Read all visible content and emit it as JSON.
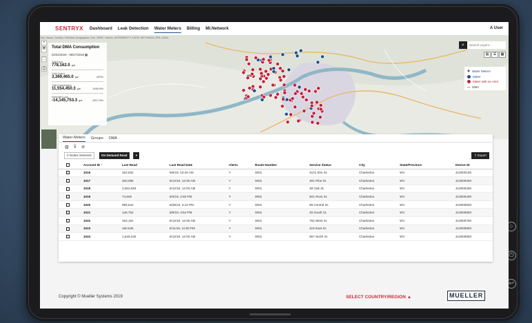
{
  "nav": {
    "logo": "SENTRYX",
    "items": [
      "Dashboard",
      "Leak Detection",
      "Water Meters",
      "Billing",
      "MI.Network"
    ],
    "active_index": 2,
    "user": "A User"
  },
  "map": {
    "attribution": "Esri, Maxar, GeoEye, Earthstar Geographics, Esri, HERE, Garmin, INCREMENT P, USGS, METI/NASA, EPA, USDA",
    "search_placeholder": "Search Layers...",
    "consumption": {
      "title": "Total DMA Consumption",
      "date_range": "01/01/2019  -  09/17/2019",
      "total_input_label": "Total Input",
      "total_input": "778,162.0",
      "total_output_label": "Total Output",
      "total_output": "3,369,465.0",
      "total_output_pct": "433%",
      "total_consumption_label": "Total Consumption",
      "total_consumption": "11,554,450.3",
      "total_consumption_pct": "1484.8%",
      "estimated_loss_label": "Estimated Loss",
      "estimated_loss": "-14,145,753.3",
      "estimated_loss_pct": "-1817.8%",
      "unit": "gal"
    },
    "legend": {
      "water_meters": "Water Meters",
      "meter": "Meter",
      "meter_alert": "Meter with an Alert",
      "dma": "DMA"
    },
    "colors": {
      "meter": "#1b4f8a",
      "alert": "#c0223a"
    }
  },
  "panel": {
    "tabs": [
      "Water Meters",
      "Groups",
      "DMA"
    ],
    "nodes_selected": "0 Nodes Selected",
    "on_demand_read": "On Demand Read",
    "export": "Export",
    "columns": [
      "Account ID",
      "Last Read",
      "Last Read Date",
      "Alerts",
      "Route Number",
      "Service Status",
      "City",
      "State/Province",
      "Device ID"
    ],
    "rows": [
      [
        "1016",
        "162,932",
        "9/6/19, 10:40 AM",
        "Y",
        "0001",
        "4101 Elm St.",
        "Charleston",
        "WV",
        "410000100"
      ],
      [
        "1017",
        "320,095",
        "8/12/19, 12:00 AM",
        "Y",
        "0001",
        "301 Pine St.",
        "Charleston",
        "WV",
        "410000200"
      ],
      [
        "1018",
        "2,562,093",
        "8/12/19, 12:00 AM",
        "Y",
        "0001",
        "38 Oak St.",
        "Charleston",
        "WV",
        "410000300"
      ],
      [
        "1019",
        "74,800",
        "9/3/19, 2:50 PM",
        "Y",
        "0001",
        "501 Rock St.",
        "Charleston",
        "WV",
        "410000400"
      ],
      [
        "1020",
        "996,542",
        "8/28/19, 3:12 PM",
        "Y",
        "0001",
        "99 Central St.",
        "Charleston",
        "WV",
        "410000500"
      ],
      [
        "1021",
        "146,752",
        "9/9/19, 3:54 PM",
        "Y",
        "0001",
        "45 South St.",
        "Charleston",
        "WV",
        "410000600"
      ],
      [
        "1022",
        "163,181",
        "8/12/19, 12:00 AM",
        "Y",
        "0001",
        "752 West St.",
        "Charleston",
        "WV",
        "410000700"
      ],
      [
        "1023",
        "180,545",
        "8/11/19, 11:00 PM",
        "Y",
        "0001",
        "419 East St.",
        "Charleston",
        "WV",
        "410000800"
      ],
      [
        "1024",
        "1,846,429",
        "8/12/19, 12:00 AM",
        "Y",
        "0001",
        "657 North St.",
        "Charleston",
        "WV",
        "410000900"
      ]
    ]
  },
  "footer": {
    "copyright": "Copyright © Mueller Systems 2019",
    "region": "SELECT COUNTRY/REGION",
    "brand": "MUELLER"
  }
}
